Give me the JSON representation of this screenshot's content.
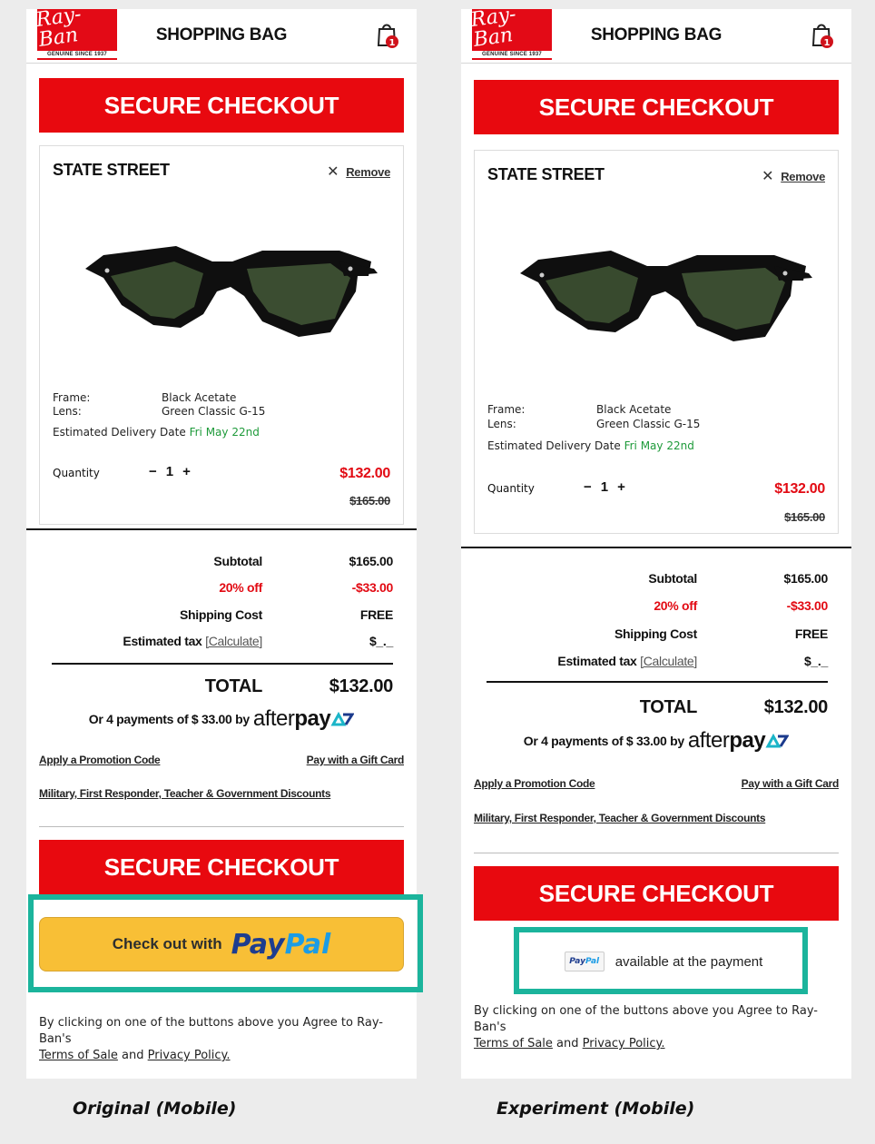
{
  "colors": {
    "brand_red": "#e8090f",
    "price_red": "#e20a13",
    "delivery_green": "#1e9a3a",
    "highlight_teal": "#1bb49c",
    "paypal_yellow": "#f8bf36"
  },
  "icons": {
    "logo": "ray-ban-logo",
    "bag": "shopping-bag-icon",
    "remove": "close-icon"
  },
  "panels": {
    "left": {
      "header": {
        "logo_text": "Ray-Ban",
        "logo_sub": "GENUINE SINCE 1937",
        "title": "SHOPPING BAG",
        "bag_count": "1"
      },
      "checkout_top": "SECURE CHECKOUT",
      "product": {
        "name": "STATE STREET",
        "remove": "Remove",
        "frame_label": "Frame:",
        "frame_value": "Black Acetate",
        "lens_label": "Lens:",
        "lens_value": "Green Classic G-15",
        "delivery_label": "Estimated Delivery Date",
        "delivery_value": "Fri May 22nd",
        "quantity_label": "Quantity",
        "quantity": "1",
        "price": "$132.00",
        "price_old": "$165.00"
      },
      "summary": {
        "subtotal_label": "Subtotal",
        "subtotal": "$165.00",
        "discount_label": "20% off",
        "discount": "-$33.00",
        "shipping_label": "Shipping Cost",
        "shipping": "FREE",
        "tax_label": "Estimated tax",
        "tax_link": "[Calculate]",
        "tax": "$_._",
        "total_label": "TOTAL",
        "total": "$132.00",
        "afterpay_text": "Or 4 payments of $ 33.00 by",
        "afterpay_a": "after",
        "afterpay_b": "pay"
      },
      "links": {
        "promo": "Apply a Promotion Code",
        "gift": "Pay with a Gift Card",
        "military": "Military, First Responder, Teacher & Government Discounts"
      },
      "checkout_bottom": "SECURE CHECKOUT",
      "paypal": {
        "prefix": "Check out with",
        "word_a": "Pay",
        "word_b": "Pal"
      },
      "terms": {
        "text": "By clicking on one of the buttons above you Agree to Ray-Ban's",
        "terms_link": "Terms of Sale",
        "and": "and",
        "privacy_link": "Privacy Policy."
      }
    },
    "right": {
      "header": {
        "logo_text": "Ray-Ban",
        "logo_sub": "GENUINE SINCE 1937",
        "title": "SHOPPING BAG",
        "bag_count": "1"
      },
      "checkout_top": "SECURE CHECKOUT",
      "product": {
        "name": "STATE STREET",
        "remove": "Remove",
        "frame_label": "Frame:",
        "frame_value": "Black Acetate",
        "lens_label": "Lens:",
        "lens_value": "Green Classic G-15",
        "delivery_label": "Estimated Delivery Date",
        "delivery_value": "Fri May 22nd",
        "quantity_label": "Quantity",
        "quantity": "1",
        "price": "$132.00",
        "price_old": "$165.00"
      },
      "summary": {
        "subtotal_label": "Subtotal",
        "subtotal": "$165.00",
        "discount_label": "20% off",
        "discount": "-$33.00",
        "shipping_label": "Shipping Cost",
        "shipping": "FREE",
        "tax_label": "Estimated tax",
        "tax_link": "[Calculate]",
        "tax": "$_._",
        "total_label": "TOTAL",
        "total": "$132.00",
        "afterpay_text": "Or 4 payments of $ 33.00 by",
        "afterpay_a": "after",
        "afterpay_b": "pay"
      },
      "links": {
        "promo": "Apply a Promotion Code",
        "gift": "Pay with a Gift Card",
        "military": "Military, First Responder, Teacher & Government Discounts"
      },
      "checkout_bottom": "SECURE CHECKOUT",
      "paypal": {
        "mini_a": "Pay",
        "mini_b": "Pal",
        "text": "available at the payment"
      },
      "terms": {
        "text": "By clicking on one of the buttons above you Agree to Ray-Ban's",
        "terms_link": "Terms of Sale",
        "and": "and",
        "privacy_link": "Privacy Policy."
      }
    }
  },
  "captions": {
    "left": "Original (Mobile)",
    "right": "Experiment (Mobile)"
  }
}
